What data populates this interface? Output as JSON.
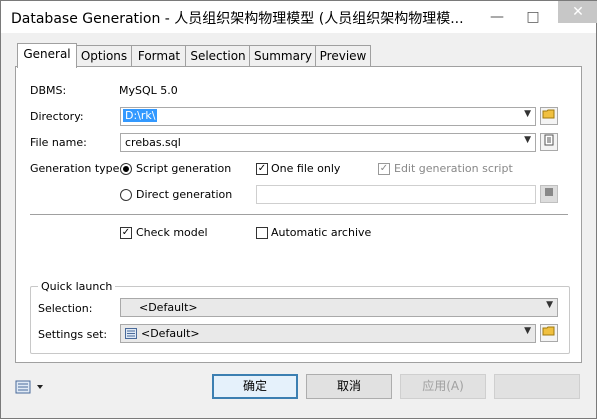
{
  "window": {
    "title": "Database Generation - 人员组织架构物理模型 (人员组织架构物理模..."
  },
  "controls": {
    "minimize": "—",
    "maximize": "□",
    "close": "✕"
  },
  "tabs": [
    {
      "label": "General",
      "active": true
    },
    {
      "label": "Options",
      "active": false
    },
    {
      "label": "Format",
      "active": false
    },
    {
      "label": "Selection",
      "active": false
    },
    {
      "label": "Summary",
      "active": false
    },
    {
      "label": "Preview",
      "active": false
    }
  ],
  "general": {
    "dbms_label": "DBMS:",
    "dbms_value": "MySQL 5.0",
    "directory_label": "Directory:",
    "directory_value": "D:\\rk\\",
    "filename_label": "File name:",
    "filename_value": "crebas.sql",
    "gentype_label": "Generation type:",
    "script_generation": "Script generation",
    "direct_generation": "Direct generation",
    "one_file_only": "One file only",
    "edit_generation_script": "Edit generation script",
    "check_model": "Check model",
    "automatic_archive": "Automatic archive"
  },
  "quick_launch": {
    "title": "Quick launch",
    "selection_label": "Selection:",
    "selection_value": "<Default>",
    "settings_label": "Settings set:",
    "settings_value": "<Default>"
  },
  "buttons": {
    "ok": "确定",
    "cancel": "取消",
    "apply": "应用(A)"
  },
  "icons": {
    "open_folder": "folder-icon",
    "properties": "properties-icon",
    "dropdown": "chevron-down-icon"
  }
}
